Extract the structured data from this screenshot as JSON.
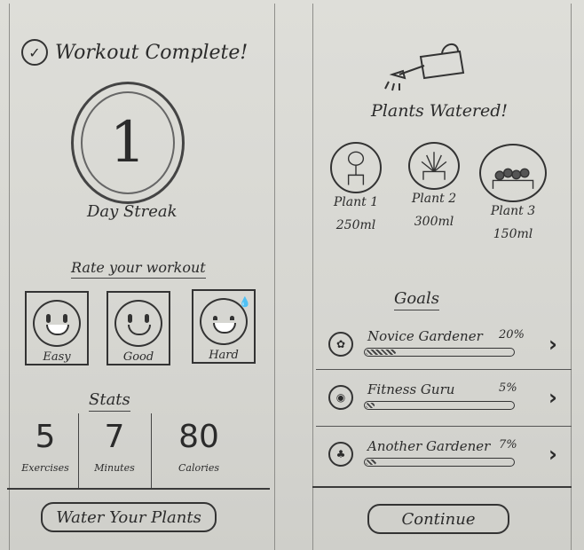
{
  "left_screen": {
    "title": "Workout Complete!",
    "check_icon": "check-icon",
    "streak_number": "1",
    "streak_label": "Day Streak",
    "rate_label": "Rate your workout",
    "ratings": [
      {
        "label": "Easy",
        "icon": "smile-face-icon"
      },
      {
        "label": "Good",
        "icon": "smile-face-icon"
      },
      {
        "label": "Hard",
        "icon": "sweat-face-icon"
      }
    ],
    "stats_title": "Stats",
    "stats": [
      {
        "value": "5",
        "label": "Exercises"
      },
      {
        "value": "7",
        "label": "Minutes"
      },
      {
        "value": "80",
        "label": "Calories"
      }
    ],
    "water_button": "Water Your Plants"
  },
  "right_screen": {
    "watering_icon": "watering-can-icon",
    "plants_title": "Plants Watered!",
    "plants": [
      {
        "name": "Plant 1",
        "amount": "250ml",
        "icon": "plant-1-icon"
      },
      {
        "name": "Plant 2",
        "amount": "300ml",
        "icon": "plant-2-icon"
      },
      {
        "name": "Plant 3",
        "amount": "150ml",
        "icon": "plant-3-icon"
      }
    ],
    "goals_title": "Goals",
    "goals": [
      {
        "name": "Novice Gardener",
        "percent": "20%",
        "progress": 0.2,
        "icon": "garden-icon"
      },
      {
        "name": "Fitness Guru",
        "percent": "5%",
        "progress": 0.05,
        "icon": "fitness-icon"
      },
      {
        "name": "Another Gardener",
        "percent": "7%",
        "progress": 0.07,
        "icon": "gardener-icon"
      }
    ],
    "continue_button": "Continue"
  }
}
